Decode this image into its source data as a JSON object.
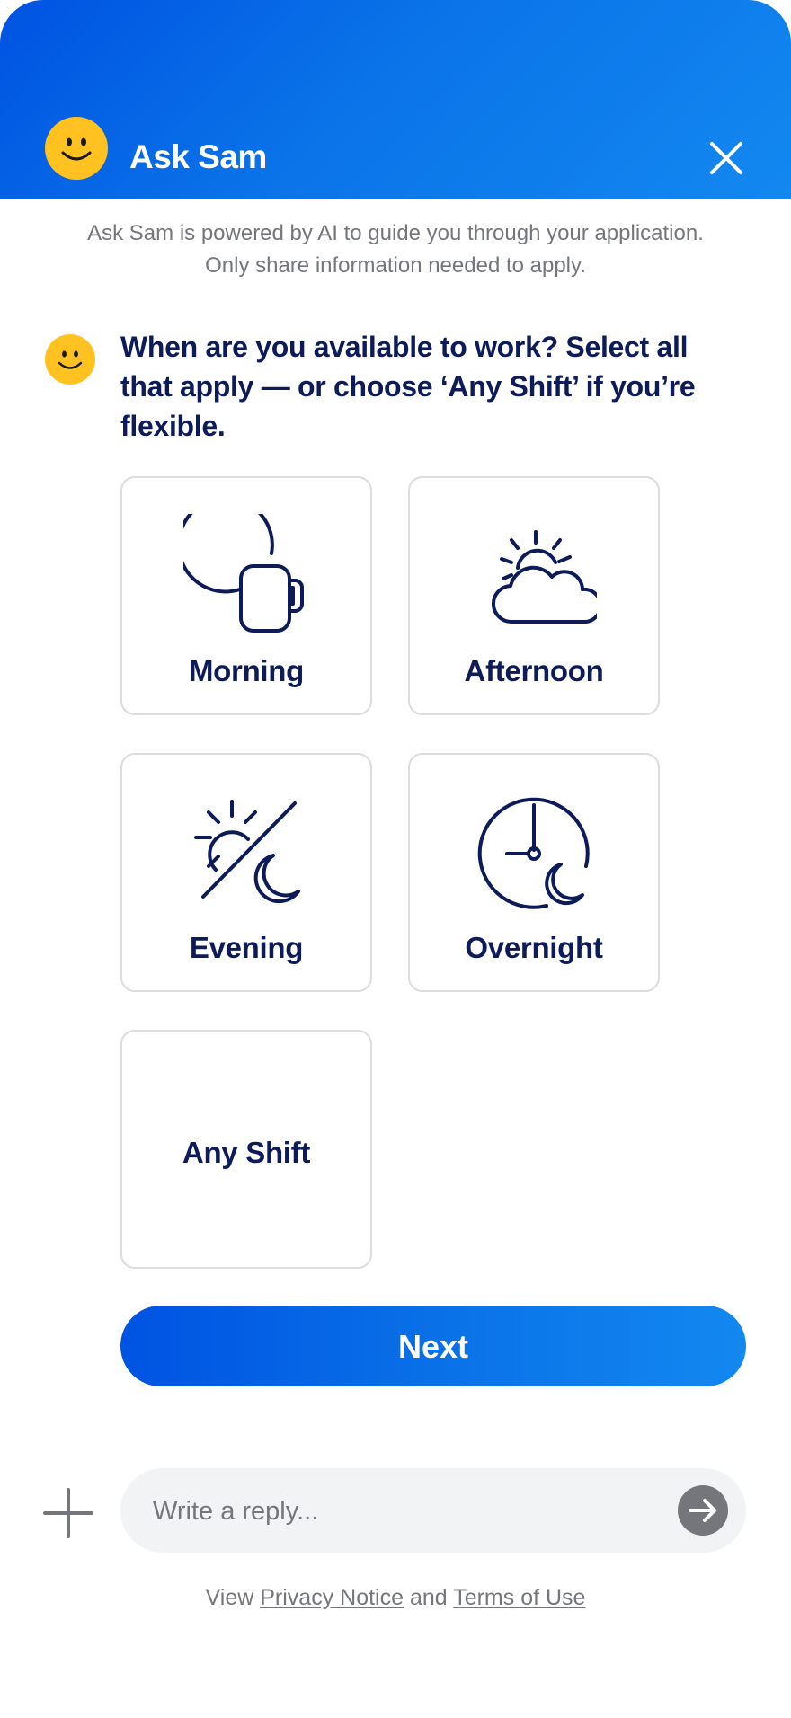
{
  "header": {
    "title": "Ask Sam",
    "avatar_icon": "smiley-icon",
    "close_icon": "close-icon",
    "background_color": "#0a73e8"
  },
  "disclaimer": {
    "line1": "Ask Sam is powered by AI to guide you through your application.",
    "line2": "Only share information needed to apply."
  },
  "message": {
    "avatar_icon": "smiley-icon",
    "text": "When are you available to work? Select all that apply — or choose ‘Any Shift’ if you’re flexible."
  },
  "options": [
    {
      "label": "Morning",
      "icon": "morning-coffee-icon"
    },
    {
      "label": "Afternoon",
      "icon": "sun-cloud-icon"
    },
    {
      "label": "Evening",
      "icon": "sun-moon-icon"
    },
    {
      "label": "Overnight",
      "icon": "clock-moon-icon"
    },
    {
      "label": "Any Shift",
      "icon": ""
    }
  ],
  "next_button": {
    "label": "Next"
  },
  "composer": {
    "placeholder": "Write a reply...",
    "add_icon": "plus-icon",
    "send_icon": "send-arrow-icon"
  },
  "footer": {
    "prefix": "View",
    "privacy_link": "Privacy Notice",
    "conjunction": "and",
    "terms_link": "Terms of Use"
  },
  "colors": {
    "brand_blue": "#0053e2",
    "text_navy": "#0d1c58",
    "smiley_yellow": "#ffc220",
    "muted_gray": "#74767c"
  }
}
